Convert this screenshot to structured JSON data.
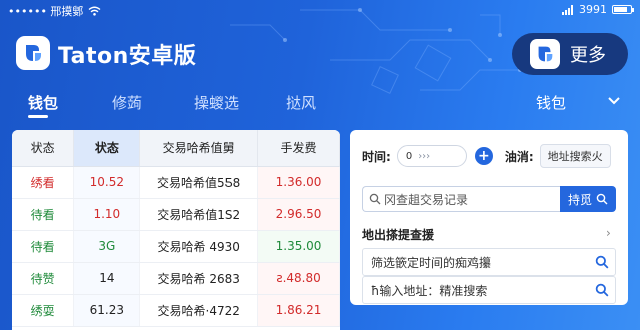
{
  "status_bar": {
    "carrier": "•••••• 邢摸鄋",
    "time": "3991"
  },
  "header": {
    "brand": "Taton安卓版",
    "more_label": "更多"
  },
  "tabs": [
    {
      "label": "钱包",
      "active": true
    },
    {
      "label": "修蒟",
      "active": false
    },
    {
      "label": "操蝬选",
      "active": false
    },
    {
      "label": "挞风",
      "active": false
    },
    {
      "label": "钱包",
      "active": false
    }
  ],
  "table": {
    "columns": [
      "状态",
      "状态",
      "交易哈希值舅",
      "手发费"
    ],
    "rows": [
      {
        "name": "绣看",
        "value": "10.52",
        "hash": "交易哈希值5Ƽ8",
        "fee": "1.36.00",
        "name_color": "red",
        "value_color": "red",
        "fee_color": "red"
      },
      {
        "name": "待看",
        "value": "1.10",
        "hash": "交易哈希值1S2",
        "fee": "2.96.50",
        "name_color": "green",
        "value_color": "red",
        "fee_color": "red"
      },
      {
        "name": "待看",
        "value": "3G",
        "hash": "交易哈希 4930",
        "fee": "1.35.00",
        "name_color": "green",
        "value_color": "green",
        "fee_color": "green"
      },
      {
        "name": "待赞",
        "value": "14",
        "hash": "交易哈希 2683",
        "fee": "ƨ.48.80",
        "name_color": "green",
        "value_color": "black",
        "fee_color": "red"
      },
      {
        "name": "绣耍",
        "value": "61.23",
        "hash": "交易哈希·4722",
        "fee": "1.86.21",
        "name_color": "green",
        "value_color": "black",
        "fee_color": "red"
      }
    ]
  },
  "panel": {
    "time_label": "时间:",
    "stepper_value": "0",
    "stepper_arrows": "›››",
    "gas_label": "油消:",
    "address_chip": "地址搜索火",
    "search_placeholder": "冈查趄交易记录",
    "search_button": "持觅",
    "section_title": "地出搽提查援",
    "filter_time": "筛选篏定时间的痴鸡攥",
    "filter_address": "ħ输入地址：精准搜索"
  },
  "colors": {
    "brand_blue": "#2467de",
    "dark_pill": "#17397f",
    "red": "#d22b2b",
    "green": "#1f8a3a"
  }
}
